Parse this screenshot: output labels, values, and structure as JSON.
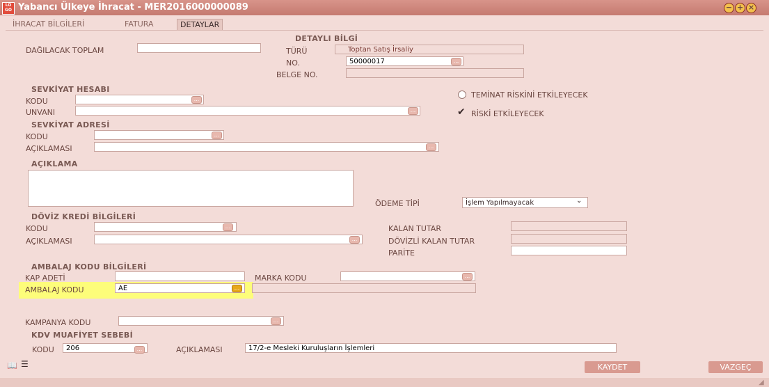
{
  "window": {
    "title": "Yabancı Ülkeye İhracat - MER2016000000089",
    "app_icon_text": "LOGO\nGO3"
  },
  "tabs": [
    {
      "label": "İHRACAT BİLGİLERİ"
    },
    {
      "label": "FATURA"
    },
    {
      "label": "DETAYLAR",
      "active": true
    }
  ],
  "form": {
    "dagilacak_toplam_label": "DAĞILACAK TOPLAM",
    "detayli_bilgi": {
      "title": "DETAYLI BİLGİ",
      "turu_label": "TÜRÜ",
      "turu_value": "Toptan Satış İrsaliy",
      "no_label": "NO.",
      "no_value": "50000017",
      "belge_no_label": "BELGE NO."
    },
    "sevkiyat_hesabi": {
      "title": "SEVKİYAT HESABI",
      "kodu_label": "KODU",
      "unvani_label": "UNVANI"
    },
    "sevkiyat_adresi": {
      "title": "SEVKİYAT ADRESİ",
      "kodu_label": "KODU",
      "aciklamasi_label": "AÇIKLAMASI"
    },
    "aciklama_label": "AÇIKLAMA",
    "checkboxes": {
      "teminat_label": "TEMİNAT RİSKİNİ ETKİLEYECEK",
      "teminat_checked": false,
      "riski_label": "RİSKİ ETKİLEYECEK",
      "riski_checked": true
    },
    "odeme_tipi_label": "ÖDEME TİPİ",
    "odeme_tipi_value": "İşlem Yapılmayacak",
    "doviz": {
      "title": "DÖVİZ KREDİ BİLGİLERİ",
      "kodu_label": "KODU",
      "aciklamasi_label": "AÇIKLAMASI",
      "kalan_tutar_label": "KALAN TUTAR",
      "dovizli_kalan_label": "DÖVİZLİ KALAN TUTAR",
      "parite_label": "PARİTE"
    },
    "ambalaj": {
      "title": "AMBALAJ KODU BİLGİLERİ",
      "kap_adeti_label": "KAP ADETİ",
      "marka_kodu_label": "MARKA KODU",
      "ambalaj_kodu_label": "AMBALAJ KODU",
      "ambalaj_kodu_value": "AE"
    },
    "kampanya_kodu_label": "KAMPANYA KODU",
    "kdv": {
      "title": "KDV MUAFİYET SEBEBİ",
      "kodu_label": "KODU",
      "kodu_value": "206",
      "aciklamasi_label": "AÇIKLAMASI",
      "aciklamasi_value": "17/2-e Mesleki Kuruluşların İşlemleri"
    }
  },
  "buttons": {
    "save": "KAYDET",
    "cancel": "VAZGEÇ",
    "ellipsis": "..."
  },
  "colors": {
    "titlebar": "#c57a70",
    "background": "#f3dcd8",
    "highlight": "#fdfd7a",
    "button": "#d99a90"
  }
}
